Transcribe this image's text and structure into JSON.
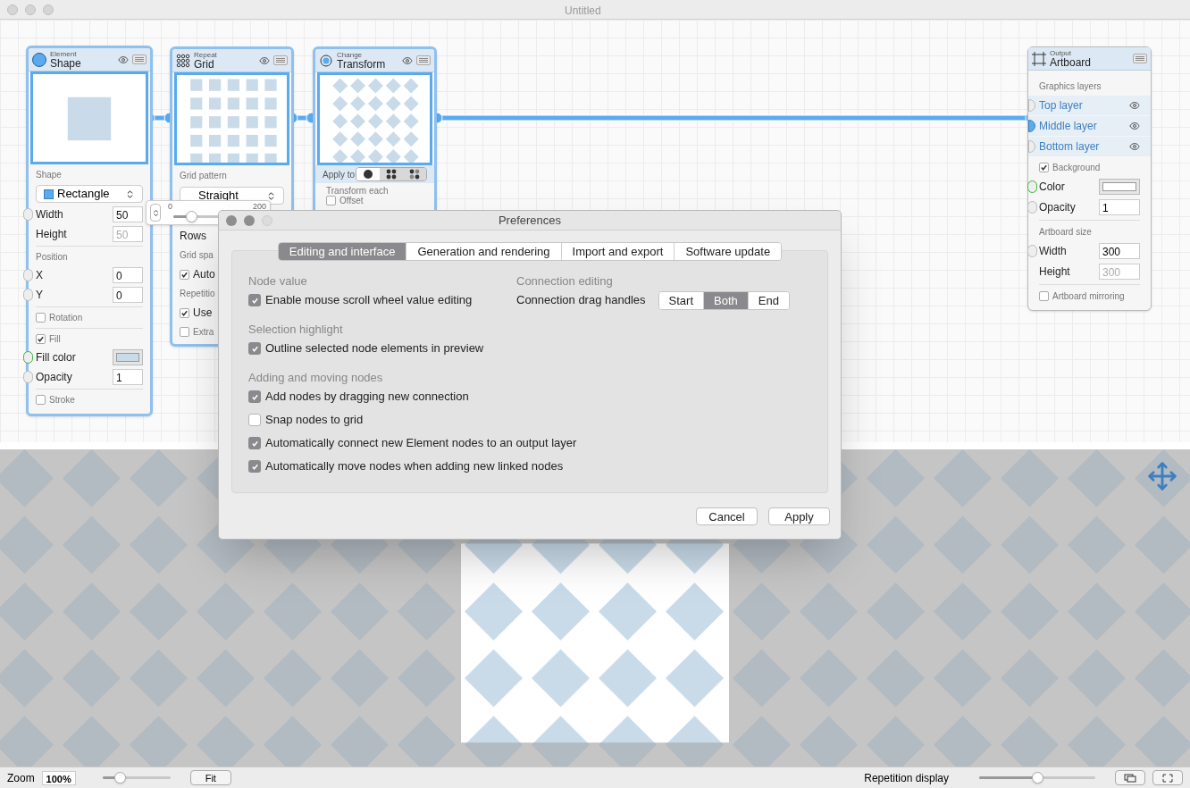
{
  "window": {
    "title": "Untitled"
  },
  "shape_node": {
    "category": "Element",
    "title": "Shape",
    "shape_label": "Shape",
    "shape_value": "Rectangle",
    "width_label": "Width",
    "width_value": "50",
    "height_label": "Height",
    "height_value": "50",
    "position_label": "Position",
    "x_label": "X",
    "x_value": "0",
    "y_label": "Y",
    "y_value": "0",
    "rotation": {
      "label": "Rotation",
      "checked": false
    },
    "fill": {
      "label": "Fill",
      "checked": true
    },
    "fill_color_label": "Fill color",
    "opacity_label": "Opacity",
    "opacity_value": "1",
    "stroke": {
      "label": "Stroke",
      "checked": false
    }
  },
  "grid_node": {
    "category": "Repeat",
    "title": "Grid",
    "pattern_label": "Grid pattern",
    "pattern_value": "Straight",
    "rows_label": "Rows",
    "spacing_label": "Grid spa",
    "auto": {
      "label": "Auto",
      "checked": true
    },
    "repetition_label": "Repetitio",
    "use": {
      "label": "Use",
      "checked": true
    },
    "extra": {
      "label": "Extra",
      "checked": false
    }
  },
  "slider_popup": {
    "min": "0",
    "max": "200",
    "level": 0.2
  },
  "transform_node": {
    "category": "Change",
    "title": "Transform",
    "apply_label": "Apply to",
    "apply_options": [
      {
        "kind": "single",
        "selected": true
      },
      {
        "kind": "grid",
        "selected": false
      },
      {
        "kind": "mixed",
        "selected": false
      }
    ],
    "transform_each_label": "Transform each",
    "offset": {
      "label": "Offset",
      "checked": false
    }
  },
  "artboard_node": {
    "category": "Output",
    "title": "Artboard",
    "layers_label": "Graphics layers",
    "layers": [
      {
        "name": "Top layer",
        "connected": false
      },
      {
        "name": "Middle layer",
        "connected": true
      },
      {
        "name": "Bottom layer",
        "connected": false
      }
    ],
    "background": {
      "label": "Background",
      "checked": true
    },
    "color_label": "Color",
    "opacity_label": "Opacity",
    "opacity_value": "1",
    "size_label": "Artboard size",
    "width_label": "Width",
    "width_value": "300",
    "height_label": "Height",
    "height_value": "300",
    "mirroring": {
      "label": "Artboard mirroring",
      "checked": false
    }
  },
  "dialog": {
    "title": "Preferences",
    "tabs": [
      {
        "label": "Editing and interface",
        "selected": true
      },
      {
        "label": "Generation and rendering",
        "selected": false
      },
      {
        "label": "Import and export",
        "selected": false
      },
      {
        "label": "Software update",
        "selected": false
      }
    ],
    "sections": [
      {
        "heading": "Node value",
        "options": [
          {
            "label": "Enable mouse scroll wheel value editing",
            "checked": true
          }
        ]
      },
      {
        "heading": "Selection highlight",
        "options": [
          {
            "label": "Outline selected node elements in preview",
            "checked": true
          }
        ]
      },
      {
        "heading": "Adding and moving nodes",
        "options": [
          {
            "label": "Add nodes by dragging new connection",
            "checked": true
          },
          {
            "label": "Snap nodes to grid",
            "checked": false
          },
          {
            "label": "Automatically connect new Element nodes to an output layer",
            "checked": true
          },
          {
            "label": "Automatically move nodes when adding new linked nodes",
            "checked": true
          }
        ]
      }
    ],
    "connection": {
      "heading": "Connection editing",
      "label": "Connection drag handles",
      "choices": [
        {
          "label": "Start",
          "selected": false
        },
        {
          "label": "Both",
          "selected": true
        },
        {
          "label": "End",
          "selected": false
        }
      ]
    },
    "buttons": [
      "Cancel",
      "Apply"
    ]
  },
  "status_bar": {
    "zoom_label": "Zoom",
    "zoom_value": "100%",
    "zoom_slider": {
      "level": 0.25
    },
    "fit_button": "Fit",
    "repetition_label": "Repetition display",
    "repetition_slider": {
      "level": 0.5
    }
  }
}
